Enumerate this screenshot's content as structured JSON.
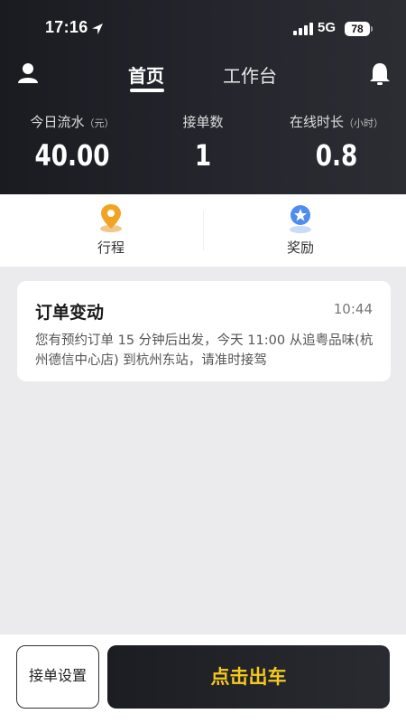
{
  "status_bar": {
    "time": "17:16",
    "network": "5G",
    "battery": "78"
  },
  "nav": {
    "tabs": [
      {
        "label": "首页",
        "active": true
      },
      {
        "label": "工作台",
        "active": false
      }
    ]
  },
  "stats": [
    {
      "label": "今日流水",
      "unit": "（元）",
      "value": "40.00"
    },
    {
      "label": "接单数",
      "unit": "",
      "value": "1"
    },
    {
      "label": "在线时长",
      "unit": "（小时）",
      "value": "0.8"
    }
  ],
  "quick_entries": [
    {
      "label": "行程",
      "icon": "map-pin-icon"
    },
    {
      "label": "奖励",
      "icon": "award-medal-icon"
    }
  ],
  "notification": {
    "title": "订单变动",
    "time": "10:44",
    "body": "您有预约订单 15 分钟后出发，今天 11:00 从追粤品味(杭州德信中心店) 到杭州东站，请准时接驾"
  },
  "bottom": {
    "settings_label": "接单设置",
    "go_label": "点击出车"
  },
  "colors": {
    "header_bg": "#1f2026",
    "accent_yellow": "#f5c81e",
    "page_bg": "#ebebed"
  }
}
